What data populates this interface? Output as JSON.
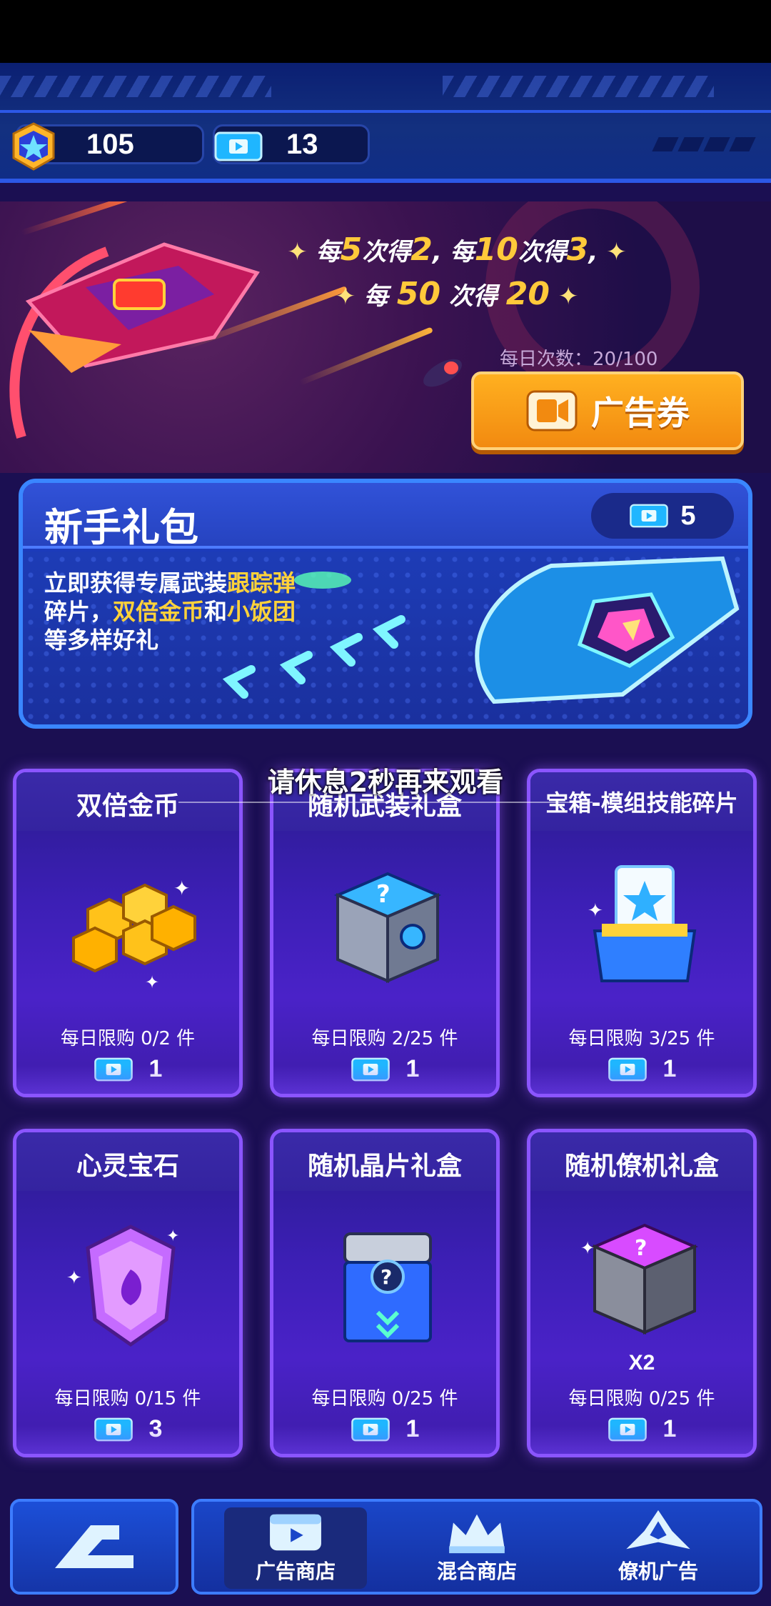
{
  "header": {
    "star_count": "105",
    "ticket_count": "13"
  },
  "hero": {
    "line1_prefix": "每",
    "line1_n1": "5",
    "line1_mid1": "次得",
    "line1_r1": "2",
    "line1_mid2": ", 每",
    "line1_n2": "10",
    "line1_mid3": "次得",
    "line1_r2": "3",
    "line1_suffix": ",",
    "line2_prefix": "每",
    "line2_n": "50",
    "line2_mid": "次得",
    "line2_r": "20",
    "daily_label": "每日次数：20/100",
    "ad_button_label": "广告券"
  },
  "newbie": {
    "title": "新手礼包",
    "price": "5",
    "desc_1": "立即获得专属武装",
    "desc_hl_1": "跟踪弹",
    "desc_2": "碎片，",
    "desc_hl_2": "双倍金币",
    "desc_3": "和",
    "desc_hl_3": "小饭团",
    "desc_4": "等多样好礼"
  },
  "toast": "请休息2秒再来观看",
  "cards": [
    {
      "name": "双倍金币",
      "limit": "每日限购 0/2 件",
      "price": "1"
    },
    {
      "name": "随机武装礼盒",
      "limit": "每日限购 2/25 件",
      "price": "1"
    },
    {
      "name": "宝箱-模组技能碎片",
      "limit": "每日限购 3/25 件",
      "price": "1"
    },
    {
      "name": "心灵宝石",
      "limit": "每日限购 0/15 件",
      "price": "3"
    },
    {
      "name": "随机晶片礼盒",
      "limit": "每日限购 0/25 件",
      "price": "1"
    },
    {
      "name": "随机僚机礼盒",
      "limit": "每日限购 0/25 件",
      "price": "1",
      "extra": "X2"
    }
  ],
  "nav": {
    "tabs": [
      {
        "label": "广告商店",
        "active": true
      },
      {
        "label": "混合商店",
        "active": false
      },
      {
        "label": "僚机广告",
        "active": false
      }
    ]
  },
  "colors": {
    "accent_gold": "#ffc93a",
    "ad_button": "#f29a14",
    "card_border": "#8b55ff",
    "nav_blue": "#1a46c8"
  }
}
